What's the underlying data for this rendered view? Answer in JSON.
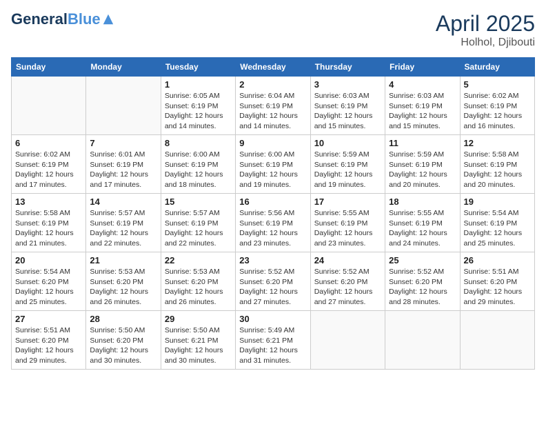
{
  "header": {
    "logo_line1": "General",
    "logo_line2": "Blue",
    "month_year": "April 2025",
    "location": "Holhol, Djibouti"
  },
  "weekdays": [
    "Sunday",
    "Monday",
    "Tuesday",
    "Wednesday",
    "Thursday",
    "Friday",
    "Saturday"
  ],
  "weeks": [
    [
      {
        "day": "",
        "info": ""
      },
      {
        "day": "",
        "info": ""
      },
      {
        "day": "1",
        "info": "Sunrise: 6:05 AM\nSunset: 6:19 PM\nDaylight: 12 hours and 14 minutes."
      },
      {
        "day": "2",
        "info": "Sunrise: 6:04 AM\nSunset: 6:19 PM\nDaylight: 12 hours and 14 minutes."
      },
      {
        "day": "3",
        "info": "Sunrise: 6:03 AM\nSunset: 6:19 PM\nDaylight: 12 hours and 15 minutes."
      },
      {
        "day": "4",
        "info": "Sunrise: 6:03 AM\nSunset: 6:19 PM\nDaylight: 12 hours and 15 minutes."
      },
      {
        "day": "5",
        "info": "Sunrise: 6:02 AM\nSunset: 6:19 PM\nDaylight: 12 hours and 16 minutes."
      }
    ],
    [
      {
        "day": "6",
        "info": "Sunrise: 6:02 AM\nSunset: 6:19 PM\nDaylight: 12 hours and 17 minutes."
      },
      {
        "day": "7",
        "info": "Sunrise: 6:01 AM\nSunset: 6:19 PM\nDaylight: 12 hours and 17 minutes."
      },
      {
        "day": "8",
        "info": "Sunrise: 6:00 AM\nSunset: 6:19 PM\nDaylight: 12 hours and 18 minutes."
      },
      {
        "day": "9",
        "info": "Sunrise: 6:00 AM\nSunset: 6:19 PM\nDaylight: 12 hours and 19 minutes."
      },
      {
        "day": "10",
        "info": "Sunrise: 5:59 AM\nSunset: 6:19 PM\nDaylight: 12 hours and 19 minutes."
      },
      {
        "day": "11",
        "info": "Sunrise: 5:59 AM\nSunset: 6:19 PM\nDaylight: 12 hours and 20 minutes."
      },
      {
        "day": "12",
        "info": "Sunrise: 5:58 AM\nSunset: 6:19 PM\nDaylight: 12 hours and 20 minutes."
      }
    ],
    [
      {
        "day": "13",
        "info": "Sunrise: 5:58 AM\nSunset: 6:19 PM\nDaylight: 12 hours and 21 minutes."
      },
      {
        "day": "14",
        "info": "Sunrise: 5:57 AM\nSunset: 6:19 PM\nDaylight: 12 hours and 22 minutes."
      },
      {
        "day": "15",
        "info": "Sunrise: 5:57 AM\nSunset: 6:19 PM\nDaylight: 12 hours and 22 minutes."
      },
      {
        "day": "16",
        "info": "Sunrise: 5:56 AM\nSunset: 6:19 PM\nDaylight: 12 hours and 23 minutes."
      },
      {
        "day": "17",
        "info": "Sunrise: 5:55 AM\nSunset: 6:19 PM\nDaylight: 12 hours and 23 minutes."
      },
      {
        "day": "18",
        "info": "Sunrise: 5:55 AM\nSunset: 6:19 PM\nDaylight: 12 hours and 24 minutes."
      },
      {
        "day": "19",
        "info": "Sunrise: 5:54 AM\nSunset: 6:19 PM\nDaylight: 12 hours and 25 minutes."
      }
    ],
    [
      {
        "day": "20",
        "info": "Sunrise: 5:54 AM\nSunset: 6:20 PM\nDaylight: 12 hours and 25 minutes."
      },
      {
        "day": "21",
        "info": "Sunrise: 5:53 AM\nSunset: 6:20 PM\nDaylight: 12 hours and 26 minutes."
      },
      {
        "day": "22",
        "info": "Sunrise: 5:53 AM\nSunset: 6:20 PM\nDaylight: 12 hours and 26 minutes."
      },
      {
        "day": "23",
        "info": "Sunrise: 5:52 AM\nSunset: 6:20 PM\nDaylight: 12 hours and 27 minutes."
      },
      {
        "day": "24",
        "info": "Sunrise: 5:52 AM\nSunset: 6:20 PM\nDaylight: 12 hours and 27 minutes."
      },
      {
        "day": "25",
        "info": "Sunrise: 5:52 AM\nSunset: 6:20 PM\nDaylight: 12 hours and 28 minutes."
      },
      {
        "day": "26",
        "info": "Sunrise: 5:51 AM\nSunset: 6:20 PM\nDaylight: 12 hours and 29 minutes."
      }
    ],
    [
      {
        "day": "27",
        "info": "Sunrise: 5:51 AM\nSunset: 6:20 PM\nDaylight: 12 hours and 29 minutes."
      },
      {
        "day": "28",
        "info": "Sunrise: 5:50 AM\nSunset: 6:20 PM\nDaylight: 12 hours and 30 minutes."
      },
      {
        "day": "29",
        "info": "Sunrise: 5:50 AM\nSunset: 6:21 PM\nDaylight: 12 hours and 30 minutes."
      },
      {
        "day": "30",
        "info": "Sunrise: 5:49 AM\nSunset: 6:21 PM\nDaylight: 12 hours and 31 minutes."
      },
      {
        "day": "",
        "info": ""
      },
      {
        "day": "",
        "info": ""
      },
      {
        "day": "",
        "info": ""
      }
    ]
  ]
}
